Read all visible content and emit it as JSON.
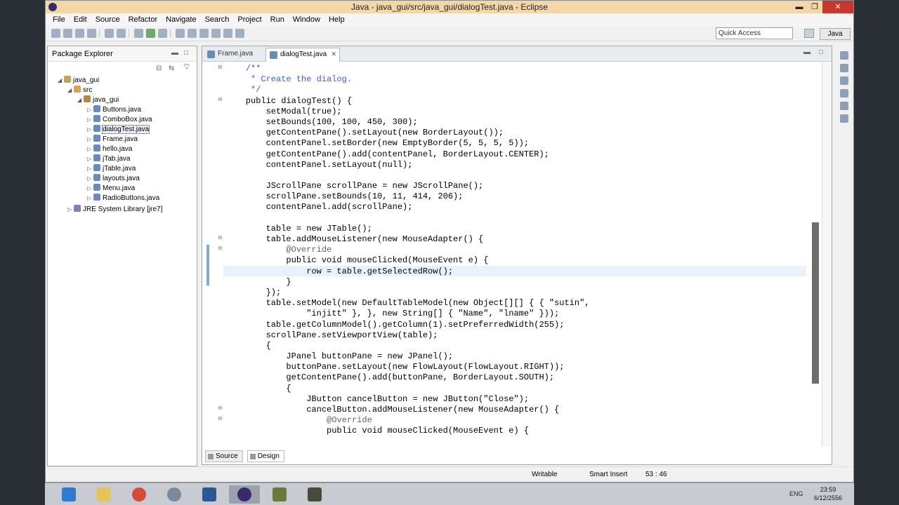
{
  "window": {
    "title": "Java - java_gui/src/java_gui/dialogTest.java - Eclipse",
    "controls": {
      "minimize": "▬",
      "maximize": "❐",
      "close": "✕"
    }
  },
  "menu": [
    "File",
    "Edit",
    "Source",
    "Refactor",
    "Navigate",
    "Search",
    "Project",
    "Run",
    "Window",
    "Help"
  ],
  "toolbar": {
    "quick_access": "Quick Access",
    "perspective": "Java"
  },
  "package_explorer": {
    "title": "Package Explorer",
    "tree": [
      {
        "label": "java_gui",
        "icon": "project-icon"
      },
      {
        "label": "src",
        "icon": "source-folder-icon"
      },
      {
        "label": "java_gui",
        "icon": "package-icon"
      },
      {
        "label": "Buttons.java",
        "icon": "java-file-icon"
      },
      {
        "label": "ComboBox.java",
        "icon": "java-file-icon"
      },
      {
        "label": "dialogTest.java",
        "icon": "java-file-icon"
      },
      {
        "label": "Frame.java",
        "icon": "java-file-icon"
      },
      {
        "label": "hello.java",
        "icon": "java-file-icon"
      },
      {
        "label": "jTab.java",
        "icon": "java-file-icon"
      },
      {
        "label": "jTable.java",
        "icon": "java-file-icon"
      },
      {
        "label": "layouts.java",
        "icon": "java-file-icon"
      },
      {
        "label": "Menu.java",
        "icon": "java-file-icon"
      },
      {
        "label": "RadioButtons.java",
        "icon": "java-file-icon"
      },
      {
        "label": "JRE System Library [jre7]",
        "icon": "library-icon"
      }
    ]
  },
  "editor": {
    "tabs": [
      "Frame.java",
      "dialogTest.java"
    ],
    "active_tab": "dialogTest.java",
    "code": [
      "    /**",
      "     * Create the dialog.",
      "     */",
      "    public dialogTest() {",
      "        setModal(true);",
      "        setBounds(100, 100, 450, 300);",
      "        getContentPane().setLayout(new BorderLayout());",
      "        contentPanel.setBorder(new EmptyBorder(5, 5, 5, 5));",
      "        getContentPane().add(contentPanel, BorderLayout.CENTER);",
      "        contentPanel.setLayout(null);",
      "",
      "        JScrollPane scrollPane = new JScrollPane();",
      "        scrollPane.setBounds(10, 11, 414, 206);",
      "        contentPanel.add(scrollPane);",
      "",
      "        table = new JTable();",
      "        table.addMouseListener(new MouseAdapter() {",
      "            @Override",
      "            public void mouseClicked(MouseEvent e) {",
      "                row = table.getSelectedRow();",
      "            }",
      "        });",
      "        table.setModel(new DefaultTableModel(new Object[][] { { \"sutin\",",
      "                \"injitt\" }, }, new String[] { \"Name\", \"lname\" }));",
      "        table.getColumnModel().getColumn(1).setPreferredWidth(255);",
      "        scrollPane.setViewportView(table);",
      "        {",
      "            JPanel buttonPane = new JPanel();",
      "            buttonPane.setLayout(new FlowLayout(FlowLayout.RIGHT));",
      "            getContentPane().add(buttonPane, BorderLayout.SOUTH);",
      "            {",
      "                JButton cancelButton = new JButton(\"Close\");",
      "                cancelButton.addMouseListener(new MouseAdapter() {",
      "                    @Override",
      "                    public void mouseClicked(MouseEvent e) {"
    ],
    "bottom_tabs": [
      "Source",
      "Design"
    ]
  },
  "status": {
    "writable": "Writable",
    "insert_mode": "Smart Insert",
    "position": "53 : 46"
  },
  "taskbar": {
    "lang": "ENG",
    "time": "23:59",
    "date": "6/12/2556"
  }
}
